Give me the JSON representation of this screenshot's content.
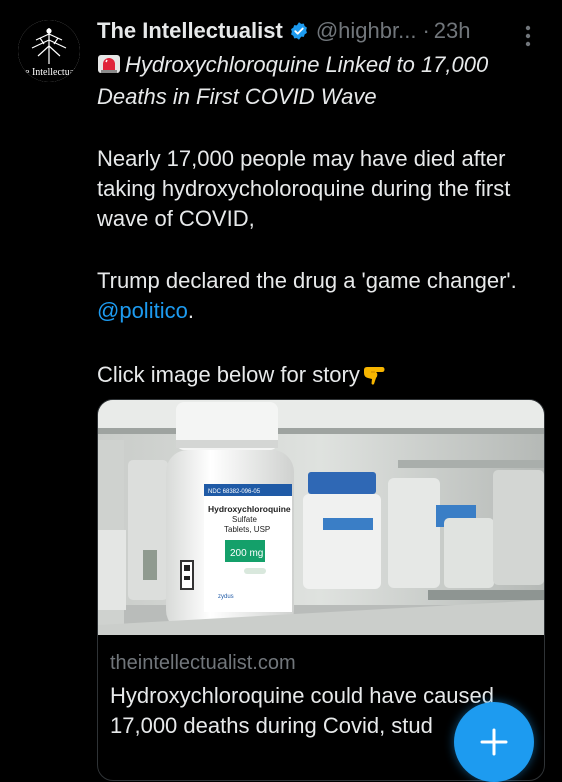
{
  "tweet": {
    "author": {
      "avatar_text": "he Intellectuali",
      "display_name": "The Intellectualist",
      "handle": "@highbr...",
      "separator": "·",
      "time": "23h"
    },
    "headline": "Hydroxychloroquine Linked to 17,000 Deaths in First COVID Wave",
    "paragraph1": "Nearly 17,000 people may have died after taking hydroxycholoroquine during the first wave of COVID,",
    "paragraph2_text": "Trump declared the drug a 'game changer'. ",
    "paragraph2_mention": "@politico",
    "paragraph2_end": ".",
    "paragraph3": "Click image below for story"
  },
  "card": {
    "image_labels": {
      "ndc": "NDC 68382-096-05",
      "drug_name_1": "Hydroxychloroquine",
      "drug_name_2": "Sulfate",
      "drug_name_3": "Tablets, USP",
      "dose": "200 mg",
      "brand": "zydus"
    },
    "domain": "theintellectualist.com",
    "title": "Hydroxychloroquine could have caused 17,000 deaths during Covid, stud"
  },
  "icons": {
    "verified": "verified-badge-icon",
    "more": "more-options-icon",
    "siren": "siren-emoji-icon",
    "pointing_hand": "pointing-hand-emoji-icon",
    "compose": "plus-icon"
  },
  "colors": {
    "background": "#000000",
    "text": "#e7e9ea",
    "muted": "#71767b",
    "accent": "#1d9bf0"
  }
}
